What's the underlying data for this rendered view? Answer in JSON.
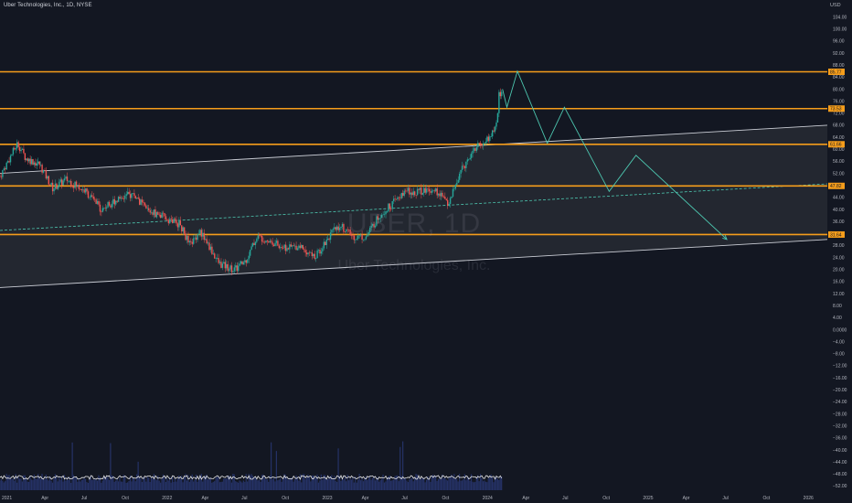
{
  "header": {
    "title": "Uber Technologies, Inc., 1D, NYSE",
    "currency": "USD"
  },
  "watermark": {
    "symbol": "UBER, 1D",
    "name": "Uber Technologies, Inc."
  },
  "colors": {
    "background": "#131722",
    "level_line": "#f59d1b",
    "channel_line": "#c9ccd4",
    "channel_fill": "#2a2d36",
    "projection": "#4dc7b0",
    "up_candle": "#26a69a",
    "down_candle": "#ef5350",
    "volume": "#2a3a78",
    "axis_text": "#b2b5be"
  },
  "chart_data": {
    "type": "candlestick",
    "symbol": "UBER",
    "interval": "1D",
    "exchange": "NYSE",
    "currency": "USD",
    "y_axis": {
      "range": [
        -54,
        106
      ],
      "ticks": [
        104,
        100,
        96,
        92,
        88,
        84,
        80,
        76,
        72,
        68,
        64,
        60,
        56,
        52,
        48,
        44,
        40,
        36,
        32,
        28,
        24,
        20,
        16,
        12,
        8,
        4,
        0,
        -4,
        -8,
        -12,
        -16,
        -20,
        -24,
        -28,
        -32,
        -36,
        -40,
        -44,
        -48,
        -52
      ],
      "tick_labels": [
        "104.00",
        "100.00",
        "96.00",
        "92.00",
        "88.00",
        "84.00",
        "80.00",
        "76.00",
        "72.00",
        "68.00",
        "64.00",
        "60.00",
        "56.00",
        "52.00",
        "48.00",
        "44.00",
        "40.00",
        "36.00",
        "32.00",
        "28.00",
        "24.00",
        "20.00",
        "16.00",
        "12.00",
        "8.00",
        "4.00",
        "0.0000",
        "−4.00",
        "−8.00",
        "−12.00",
        "−16.00",
        "−20.00",
        "−24.00",
        "−28.00",
        "−32.00",
        "−36.00",
        "−40.00",
        "−44.00",
        "−48.00",
        "−52.00"
      ]
    },
    "x_axis": {
      "range": [
        "2021-01-01",
        "2026-03-01"
      ],
      "ticks": [
        {
          "date": "2021-01-01",
          "label": "2021"
        },
        {
          "date": "2021-04-01",
          "label": "Apr"
        },
        {
          "date": "2021-07-01",
          "label": "Jul"
        },
        {
          "date": "2021-10-01",
          "label": "Oct"
        },
        {
          "date": "2022-01-01",
          "label": "2022"
        },
        {
          "date": "2022-04-01",
          "label": "Apr"
        },
        {
          "date": "2022-07-01",
          "label": "Jul"
        },
        {
          "date": "2022-10-01",
          "label": "Oct"
        },
        {
          "date": "2023-01-01",
          "label": "2023"
        },
        {
          "date": "2023-04-01",
          "label": "Apr"
        },
        {
          "date": "2023-07-01",
          "label": "Jul"
        },
        {
          "date": "2023-10-01",
          "label": "Oct"
        },
        {
          "date": "2024-01-01",
          "label": "2024"
        },
        {
          "date": "2024-04-01",
          "label": "Apr"
        },
        {
          "date": "2024-07-01",
          "label": "Jul"
        },
        {
          "date": "2024-10-01",
          "label": "Oct"
        },
        {
          "date": "2025-01-01",
          "label": "2025"
        },
        {
          "date": "2025-04-01",
          "label": "Apr"
        },
        {
          "date": "2025-07-01",
          "label": "Jul"
        },
        {
          "date": "2025-10-01",
          "label": "Oct"
        },
        {
          "date": "2026-01-01",
          "label": "2026"
        }
      ]
    },
    "price_path": [
      {
        "date": "2021-01-01",
        "close": 51
      },
      {
        "date": "2021-02-10",
        "close": 62
      },
      {
        "date": "2021-03-01",
        "close": 57
      },
      {
        "date": "2021-04-01",
        "close": 55
      },
      {
        "date": "2021-05-01",
        "close": 47
      },
      {
        "date": "2021-06-01",
        "close": 50
      },
      {
        "date": "2021-07-15",
        "close": 46
      },
      {
        "date": "2021-08-20",
        "close": 40
      },
      {
        "date": "2021-10-01",
        "close": 44
      },
      {
        "date": "2021-11-01",
        "close": 45
      },
      {
        "date": "2021-12-01",
        "close": 40
      },
      {
        "date": "2022-01-15",
        "close": 37
      },
      {
        "date": "2022-02-15",
        "close": 35
      },
      {
        "date": "2022-03-10",
        "close": 28
      },
      {
        "date": "2022-04-01",
        "close": 33
      },
      {
        "date": "2022-05-15",
        "close": 22
      },
      {
        "date": "2022-06-20",
        "close": 20
      },
      {
        "date": "2022-07-15",
        "close": 23
      },
      {
        "date": "2022-08-10",
        "close": 31
      },
      {
        "date": "2022-09-01",
        "close": 30
      },
      {
        "date": "2022-10-15",
        "close": 27
      },
      {
        "date": "2022-11-15",
        "close": 28
      },
      {
        "date": "2022-12-20",
        "close": 24
      },
      {
        "date": "2023-01-20",
        "close": 31
      },
      {
        "date": "2023-02-15",
        "close": 35
      },
      {
        "date": "2023-03-15",
        "close": 31
      },
      {
        "date": "2023-04-15",
        "close": 31
      },
      {
        "date": "2023-05-15",
        "close": 38
      },
      {
        "date": "2023-06-15",
        "close": 42
      },
      {
        "date": "2023-07-15",
        "close": 46
      },
      {
        "date": "2023-08-15",
        "close": 46
      },
      {
        "date": "2023-09-15",
        "close": 47
      },
      {
        "date": "2023-10-20",
        "close": 42
      },
      {
        "date": "2023-11-15",
        "close": 52
      },
      {
        "date": "2023-12-15",
        "close": 60
      },
      {
        "date": "2024-01-15",
        "close": 63
      },
      {
        "date": "2024-02-01",
        "close": 66
      },
      {
        "date": "2024-02-08",
        "close": 70
      },
      {
        "date": "2024-02-12",
        "close": 78
      },
      {
        "date": "2024-02-20",
        "close": 80
      }
    ],
    "horizontal_levels": [
      {
        "price": 85.77,
        "label": "85.77"
      },
      {
        "price": 73.53,
        "label": "73.53"
      },
      {
        "price": 61.66,
        "label": "61.66"
      },
      {
        "price": 47.82,
        "label": "47.82"
      },
      {
        "price": 31.64,
        "label": "31.64"
      }
    ],
    "channel": {
      "upper": [
        {
          "date": "2021-01-01",
          "price": 52
        },
        {
          "date": "2026-03-01",
          "price": 68
        }
      ],
      "mid": [
        {
          "date": "2021-01-01",
          "price": 33
        },
        {
          "date": "2026-03-01",
          "price": 48.5
        }
      ],
      "lower": [
        {
          "date": "2021-01-01",
          "price": 14
        },
        {
          "date": "2026-03-01",
          "price": 30
        }
      ]
    },
    "projection_path": [
      {
        "date": "2024-02-20",
        "price": 80
      },
      {
        "date": "2024-03-01",
        "price": 74
      },
      {
        "date": "2024-03-25",
        "price": 86
      },
      {
        "date": "2024-06-01",
        "price": 62
      },
      {
        "date": "2024-07-10",
        "price": 74
      },
      {
        "date": "2024-10-20",
        "price": 46
      },
      {
        "date": "2024-12-20",
        "price": 58
      },
      {
        "date": "2025-07-15",
        "price": 30
      }
    ],
    "volume_axis_note": "volume histogram at bottom, scale not printed",
    "grid": false,
    "legend": "none"
  }
}
